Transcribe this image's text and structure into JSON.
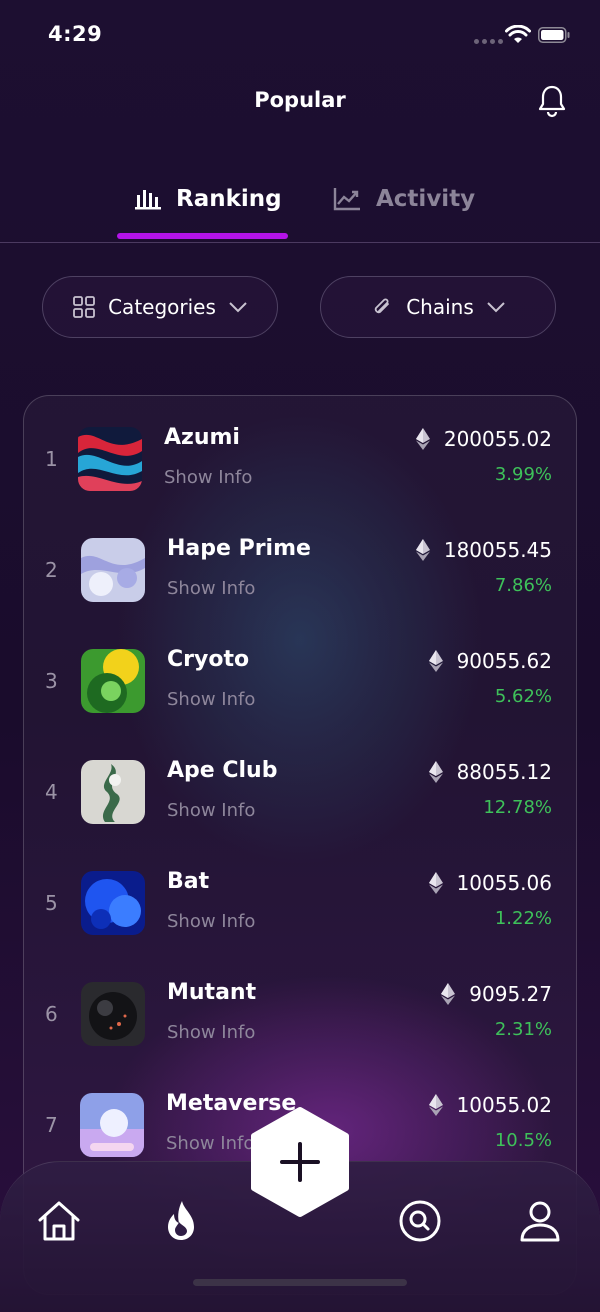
{
  "status": {
    "time": "4:29"
  },
  "header": {
    "title": "Popular"
  },
  "tabs": [
    {
      "label": "Ranking",
      "active": true,
      "icon": "bar-chart-icon"
    },
    {
      "label": "Activity",
      "active": false,
      "icon": "line-chart-icon"
    }
  ],
  "filters": [
    {
      "label": "Categories",
      "icon": "grid-icon"
    },
    {
      "label": "Chains",
      "icon": "paperclip-icon"
    }
  ],
  "rows": [
    {
      "rank": "1",
      "name": "Azumi",
      "info": "Show Info",
      "price": "200055.02",
      "change": "3.99%"
    },
    {
      "rank": "2",
      "name": "Hape Prime",
      "info": "Show Info",
      "price": "180055.45",
      "change": "7.86%"
    },
    {
      "rank": "3",
      "name": "Cryoto",
      "info": "Show Info",
      "price": "90055.62",
      "change": "5.62%"
    },
    {
      "rank": "4",
      "name": "Ape Club",
      "info": "Show Info",
      "price": "88055.12",
      "change": "12.78%"
    },
    {
      "rank": "5",
      "name": "Bat",
      "info": "Show Info",
      "price": "10055.06",
      "change": "1.22%"
    },
    {
      "rank": "6",
      "name": "Mutant",
      "info": "Show Info",
      "price": "9095.27",
      "change": "2.31%"
    },
    {
      "rank": "7",
      "name": "Metaverse",
      "info": "Show Info",
      "price": "10055.02",
      "change": "10.5%"
    }
  ],
  "colors": {
    "accent": "#b313e8",
    "positive": "#3ec15a",
    "background": "#1c0f30"
  },
  "nav": [
    "home-icon",
    "flame-icon",
    "plus-icon",
    "search-icon",
    "user-icon"
  ]
}
